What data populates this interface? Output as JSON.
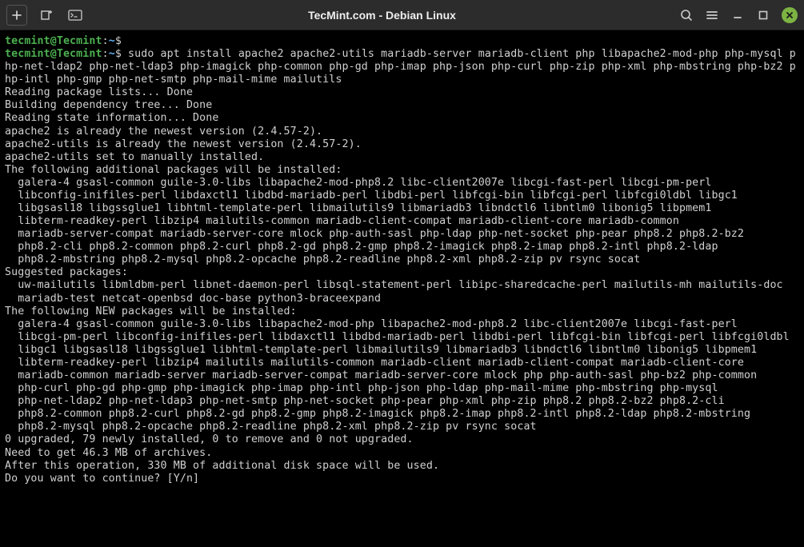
{
  "titlebar": {
    "title": "TecMint.com - Debian Linux"
  },
  "prompt": {
    "user": "tecmint@Tecmint",
    "colon": ":",
    "path": "~",
    "dollar": "$"
  },
  "command": "sudo apt install apache2 apache2-utils mariadb-server mariadb-client php libapache2-mod-php php-mysql php-net-ldap2 php-net-ldap3 php-imagick php-common php-gd php-imap php-json php-curl php-zip php-xml php-mbstring php-bz2 php-intl php-gmp php-net-smtp php-mail-mime mailutils",
  "output": {
    "reading_lists": "Reading package lists... Done",
    "building_tree": "Building dependency tree... Done",
    "reading_state": "Reading state information... Done",
    "apache_newest": "apache2 is already the newest version (2.4.57-2).",
    "apache_utils_newest": "apache2-utils is already the newest version (2.4.57-2).",
    "apache_utils_manual": "apache2-utils set to manually installed.",
    "additional_header": "The following additional packages will be installed:",
    "additional_packages": "  galera-4 gsasl-common guile-3.0-libs libapache2-mod-php8.2 libc-client2007e libcgi-fast-perl libcgi-pm-perl\n  libconfig-inifiles-perl libdaxctl1 libdbd-mariadb-perl libdbi-perl libfcgi-bin libfcgi-perl libfcgi0ldbl libgc1\n  libgsasl18 libgssglue1 libhtml-template-perl libmailutils9 libmariadb3 libndctl6 libntlm0 libonig5 libpmem1\n  libterm-readkey-perl libzip4 mailutils-common mariadb-client-compat mariadb-client-core mariadb-common\n  mariadb-server-compat mariadb-server-core mlock php-auth-sasl php-ldap php-net-socket php-pear php8.2 php8.2-bz2\n  php8.2-cli php8.2-common php8.2-curl php8.2-gd php8.2-gmp php8.2-imagick php8.2-imap php8.2-intl php8.2-ldap\n  php8.2-mbstring php8.2-mysql php8.2-opcache php8.2-readline php8.2-xml php8.2-zip pv rsync socat",
    "suggested_header": "Suggested packages:",
    "suggested_packages": "  uw-mailutils libmldbm-perl libnet-daemon-perl libsql-statement-perl libipc-sharedcache-perl mailutils-mh mailutils-doc\n  mariadb-test netcat-openbsd doc-base python3-braceexpand",
    "new_header": "The following NEW packages will be installed:",
    "new_packages": "  galera-4 gsasl-common guile-3.0-libs libapache2-mod-php libapache2-mod-php8.2 libc-client2007e libcgi-fast-perl\n  libcgi-pm-perl libconfig-inifiles-perl libdaxctl1 libdbd-mariadb-perl libdbi-perl libfcgi-bin libfcgi-perl libfcgi0ldbl\n  libgc1 libgsasl18 libgssglue1 libhtml-template-perl libmailutils9 libmariadb3 libndctl6 libntlm0 libonig5 libpmem1\n  libterm-readkey-perl libzip4 mailutils mailutils-common mariadb-client mariadb-client-compat mariadb-client-core\n  mariadb-common mariadb-server mariadb-server-compat mariadb-server-core mlock php php-auth-sasl php-bz2 php-common\n  php-curl php-gd php-gmp php-imagick php-imap php-intl php-json php-ldap php-mail-mime php-mbstring php-mysql\n  php-net-ldap2 php-net-ldap3 php-net-smtp php-net-socket php-pear php-xml php-zip php8.2 php8.2-bz2 php8.2-cli\n  php8.2-common php8.2-curl php8.2-gd php8.2-gmp php8.2-imagick php8.2-imap php8.2-intl php8.2-ldap php8.2-mbstring\n  php8.2-mysql php8.2-opcache php8.2-readline php8.2-xml php8.2-zip pv rsync socat",
    "summary": "0 upgraded, 79 newly installed, 0 to remove and 0 not upgraded.",
    "need_get": "Need to get 46.3 MB of archives.",
    "after_op": "After this operation, 330 MB of additional disk space will be used.",
    "continue_prompt": "Do you want to continue? [Y/n] "
  }
}
